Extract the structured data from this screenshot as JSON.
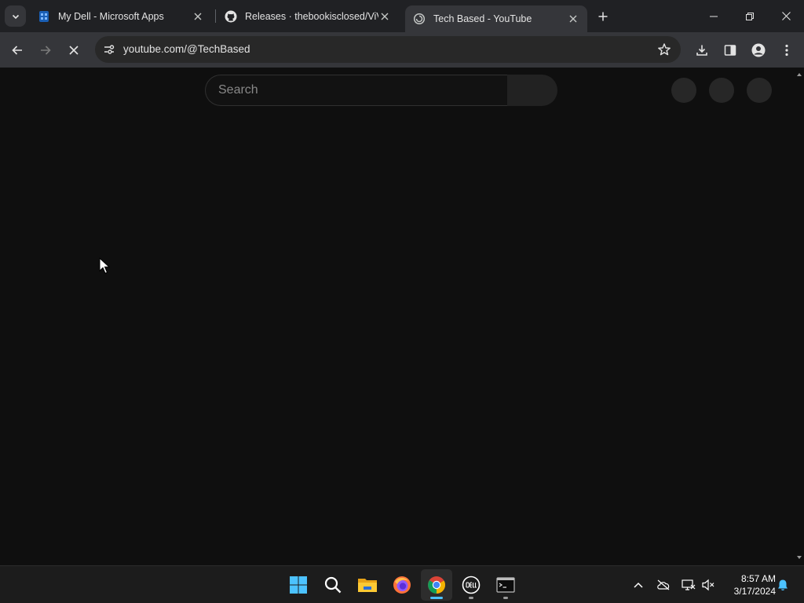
{
  "browser": {
    "tabs": [
      {
        "title": "My Dell - Microsoft Apps",
        "active": false,
        "favicon": "dell-store-icon"
      },
      {
        "title": "Releases · thebookisclosed/ViVe",
        "active": false,
        "favicon": "github-icon"
      },
      {
        "title": "Tech Based - YouTube",
        "active": true,
        "favicon": "loading-globe-icon"
      }
    ],
    "url": "youtube.com/@TechBased",
    "loading": true
  },
  "page": {
    "search_placeholder": "Search"
  },
  "taskbar": {
    "apps": [
      {
        "name": "start",
        "icon": "windows-logo-icon"
      },
      {
        "name": "search",
        "icon": "search-icon"
      },
      {
        "name": "file-explorer",
        "icon": "folder-icon"
      },
      {
        "name": "firefox",
        "icon": "firefox-icon"
      },
      {
        "name": "chrome",
        "icon": "chrome-icon",
        "active": true
      },
      {
        "name": "dell",
        "icon": "dell-icon"
      },
      {
        "name": "terminal",
        "icon": "terminal-icon"
      }
    ],
    "clock": {
      "time": "8:57 AM",
      "date": "3/17/2024"
    }
  },
  "colors": {
    "accent": "#4cc2ff",
    "page_bg": "#0f0f0f",
    "toolbar_bg": "#35363a",
    "tabstrip_bg": "#202124"
  }
}
